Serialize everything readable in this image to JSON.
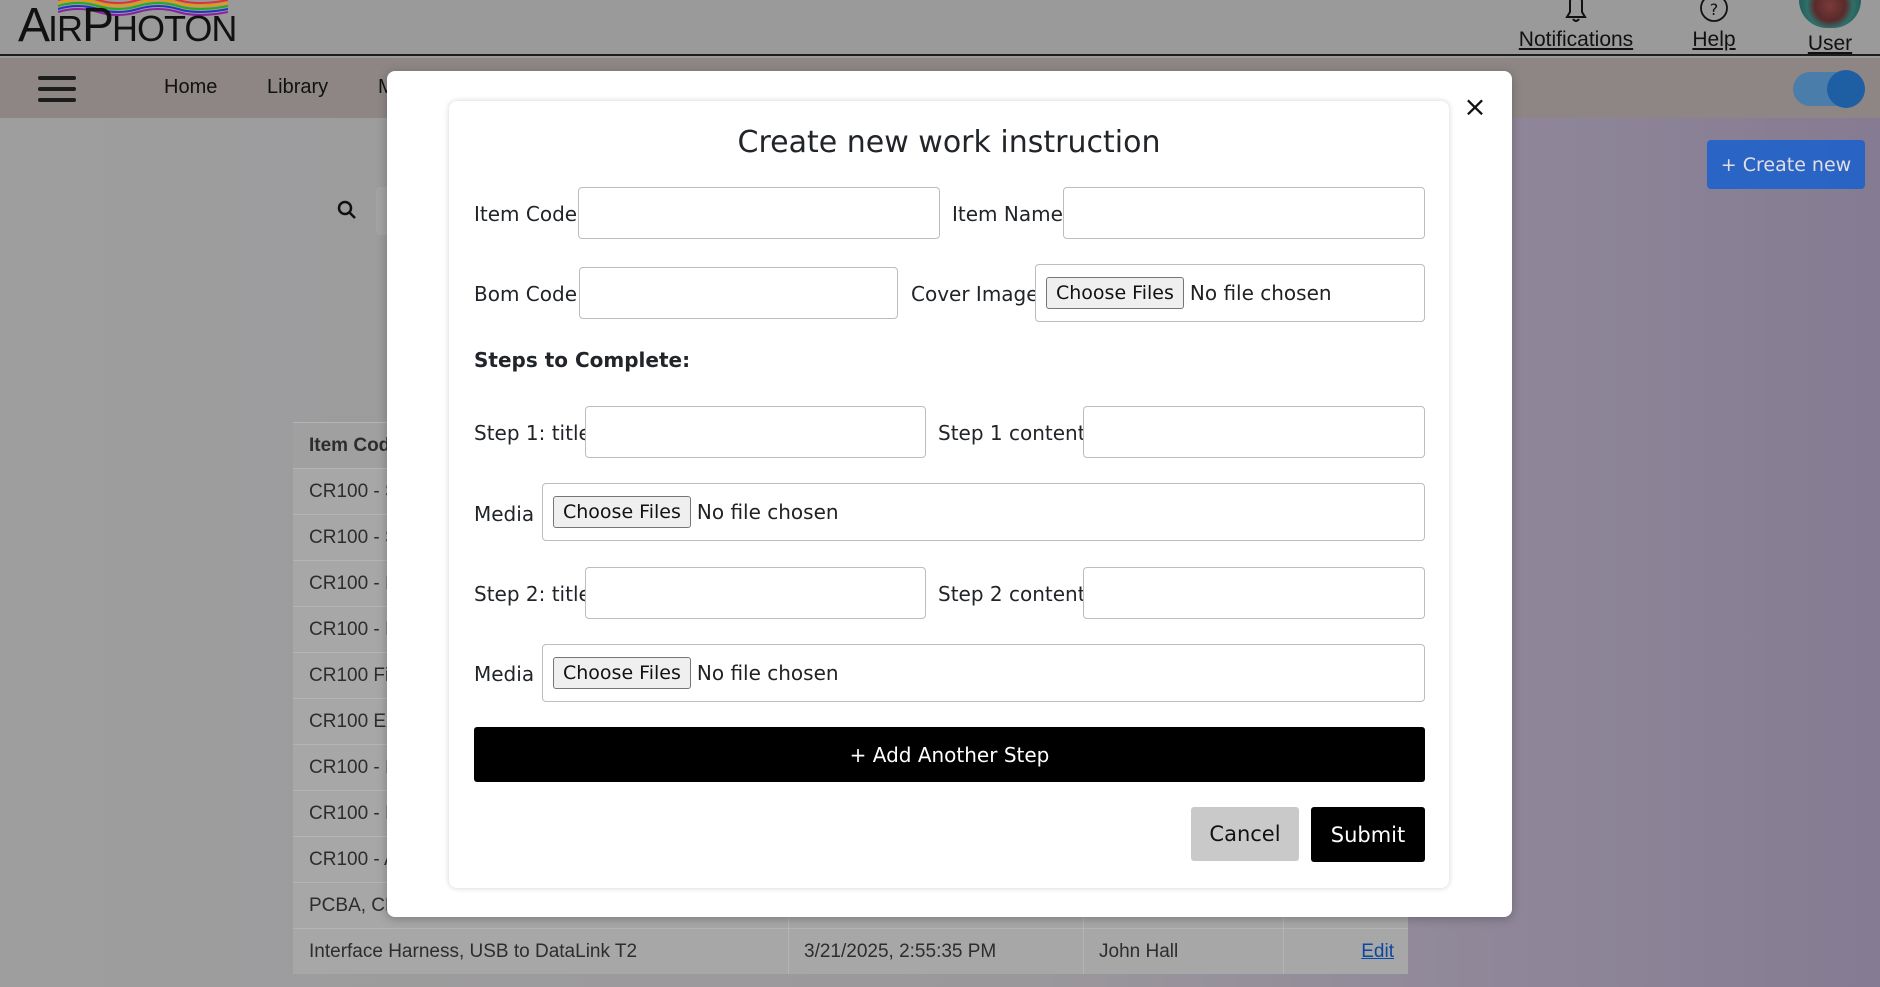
{
  "header": {
    "logo_text_big": "A",
    "logo_text_mid": "IR",
    "logo_text_p": "P",
    "logo_text_rest": "HOTON",
    "notifications_label": "Notifications",
    "help_label": "Help",
    "user_label": "User"
  },
  "nav": {
    "items": [
      "Home",
      "Library",
      "M"
    ],
    "toggle_on": true
  },
  "page": {
    "create_new_label": "+ Create new",
    "table": {
      "header": [
        "Item Cod"
      ],
      "rows": [
        [
          "CR100 - S",
          "",
          "",
          ""
        ],
        [
          "CR100 - S",
          "",
          "",
          ""
        ],
        [
          "CR100 - I",
          "",
          "",
          ""
        ],
        [
          "CR100 - I",
          "",
          "",
          ""
        ],
        [
          "CR100 Fi",
          "",
          "",
          ""
        ],
        [
          "CR100 Ex",
          "",
          "",
          ""
        ],
        [
          "CR100 - I",
          "",
          "",
          ""
        ],
        [
          "CR100 - I",
          "",
          "",
          ""
        ],
        [
          "CR100 - A",
          "",
          "",
          ""
        ],
        [
          "PCBA, CR",
          "",
          "",
          ""
        ],
        [
          "Interface Harness, USB to DataLink T2",
          "3/21/2025, 2:55:35 PM",
          "John Hall",
          "Edit"
        ]
      ]
    }
  },
  "modal": {
    "title": "Create new work instruction",
    "close_glyph": "×",
    "item_code_label": "Item Code",
    "item_code_value": "",
    "item_name_label": "Item Name",
    "item_name_value": "",
    "bom_code_label": "Bom Code",
    "bom_code_value": "",
    "cover_image_label": "Cover Image",
    "choose_files_label": "Choose Files",
    "no_file_label": "No file chosen",
    "steps_heading": "Steps to Complete:",
    "steps": [
      {
        "title_label": "Step 1: title",
        "title_value": "",
        "content_label": "Step 1 content:",
        "content_value": "",
        "media_label": "Media"
      },
      {
        "title_label": "Step 2: title",
        "title_value": "",
        "content_label": "Step 2 content:",
        "content_value": "",
        "media_label": "Media"
      }
    ],
    "add_step_label": "+ Add Another Step",
    "cancel_label": "Cancel",
    "submit_label": "Submit"
  }
}
